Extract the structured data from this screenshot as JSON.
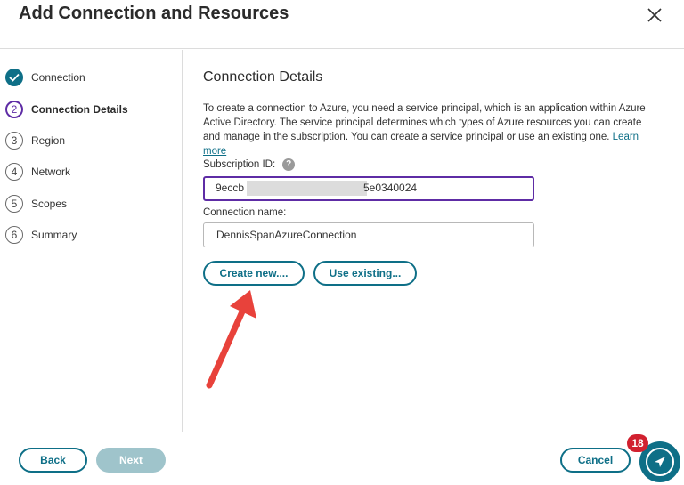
{
  "dialog": {
    "title": "Add Connection and Resources"
  },
  "steps": [
    {
      "number": "",
      "label": "Connection",
      "state": "done"
    },
    {
      "number": "2",
      "label": "Connection Details",
      "state": "active"
    },
    {
      "number": "3",
      "label": "Region",
      "state": "pending"
    },
    {
      "number": "4",
      "label": "Network",
      "state": "pending"
    },
    {
      "number": "5",
      "label": "Scopes",
      "state": "pending"
    },
    {
      "number": "6",
      "label": "Summary",
      "state": "pending"
    }
  ],
  "main": {
    "section_title": "Connection Details",
    "description": "To create a connection to Azure, you need a service principal, which is an application within Azure Active Directory. The service principal determines which types of Azure resources you can create and manage in the subscription. You can create a service principal or use an existing one.",
    "learn_more": "Learn more",
    "subscription_label": "Subscription ID:",
    "subscription_value_start": "9eccb",
    "subscription_value_end": "5e0340024",
    "connection_name_label": "Connection name:",
    "connection_name_value": "DennisSpanAzureConnection",
    "create_new_label": "Create new....",
    "use_existing_label": "Use existing..."
  },
  "footer": {
    "back_label": "Back",
    "next_label": "Next",
    "cancel_label": "Cancel",
    "notification_count": "18"
  },
  "colors": {
    "accent": "#0e6f87",
    "active_step": "#5e2ca5",
    "annotation_arrow": "#e8423b",
    "badge": "#d1202f"
  }
}
